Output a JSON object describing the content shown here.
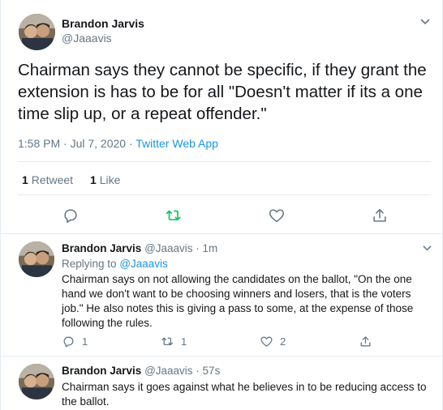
{
  "main_tweet": {
    "author_name": "Brandon Jarvis",
    "author_handle": "@Jaaavis",
    "text": "Chairman says they cannot be specific, if they grant the extension is has to be for all \"Doesn't matter if its a one time slip up, or a repeat offender.\"",
    "time": "1:58 PM · Jul 7, 2020",
    "separator": " · ",
    "source": "Twitter Web App",
    "retweet_count": "1",
    "retweet_label": "Retweet",
    "like_count": "1",
    "like_label": "Like",
    "icons": [
      "reply-icon",
      "retweet-icon",
      "like-icon",
      "share-icon",
      "chevron-down-icon"
    ],
    "colors": {
      "retweet_active": "#17bf63",
      "link": "#1b95e0",
      "secondary": "#657786"
    }
  },
  "replies": [
    {
      "author_name": "Brandon Jarvis",
      "author_handle": "@Jaaavis",
      "age": "1m",
      "replying_to_label": "Replying to",
      "replying_to_handle": "@Jaaavis",
      "text": "Chairman says on not allowing the candidates on the ballot, \"On the one hand we don't want to be choosing winners and losers, that is the voters job.\" He also notes this is giving a pass to some, at the expense of those following the rules.",
      "reply_count": "1",
      "retweet_count": "1",
      "like_count": "2"
    },
    {
      "author_name": "Brandon Jarvis",
      "author_handle": "@Jaaavis",
      "age": "57s",
      "text": "Chairman says it goes against what he believes in to be reducing access to the ballot."
    }
  ]
}
